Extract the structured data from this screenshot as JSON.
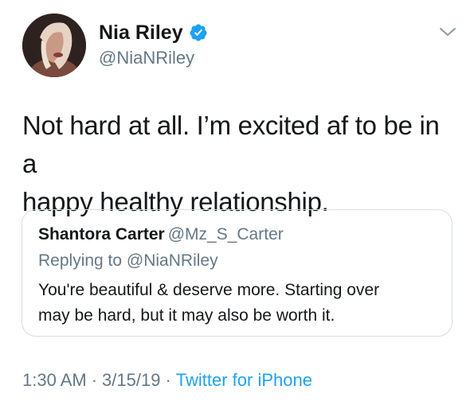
{
  "author": {
    "display_name": "Nia Riley",
    "handle": "@NiaNRiley",
    "verified": true,
    "avatar_icon": "profile-photo"
  },
  "menu": {
    "icon": "chevron-down-icon"
  },
  "tweet": {
    "text_line1": "Not hard at all. I’m excited af to be in a",
    "text_line2": "happy healthy relationship."
  },
  "quote": {
    "display_name": "Shantora Carter",
    "handle": "@Mz_S_Carter",
    "replying_prefix": "Replying to",
    "replying_to": "@NiaNRiley",
    "text_line1": "You're beautiful & deserve more. Starting over",
    "text_line2": "may be hard, but it may also be worth it."
  },
  "meta": {
    "time": "1:30 AM",
    "date": "3/15/19",
    "separator": "·",
    "source": "Twitter for iPhone"
  },
  "colors": {
    "text": "#14171a",
    "secondary": "#657786",
    "accent": "#1da1f2",
    "border": "#d8dee3"
  }
}
